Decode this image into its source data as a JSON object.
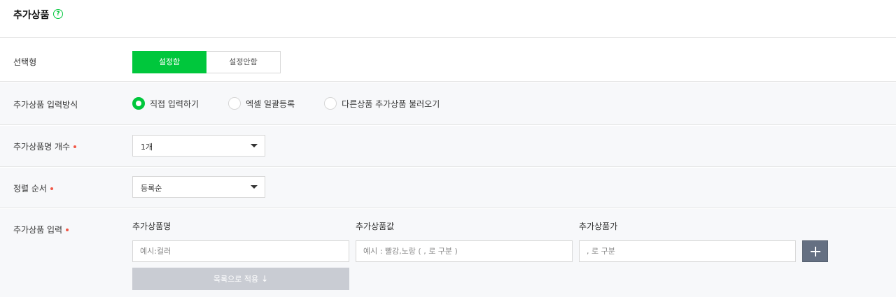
{
  "header": {
    "title": "추가상품",
    "help_icon": "?"
  },
  "selection": {
    "label": "선택형",
    "options": [
      "설정함",
      "설정안함"
    ],
    "selected": "설정함"
  },
  "input_method": {
    "label": "추가상품 입력방식",
    "options": [
      "직접 입력하기",
      "엑셀 일괄등록",
      "다른상품 추가상품 불러오기"
    ],
    "selected": "직접 입력하기"
  },
  "name_count": {
    "label": "추가상품명 개수",
    "value": "1개"
  },
  "sort_order": {
    "label": "정렬 순서",
    "value": "등록순"
  },
  "product_input": {
    "label": "추가상품 입력",
    "columns": [
      "추가상품명",
      "추가상품값",
      "추가상품가"
    ],
    "placeholders": [
      "예시:컬러",
      "예시 : 빨강,노랑 ( , 로 구분 )",
      ", 로 구분"
    ],
    "apply_label": "목록으로 적용",
    "apply_arrow": "↓"
  },
  "colors": {
    "accent": "#00c73c",
    "required": "#f15746",
    "add_button": "#657082",
    "apply_button": "#c9ccd3"
  }
}
